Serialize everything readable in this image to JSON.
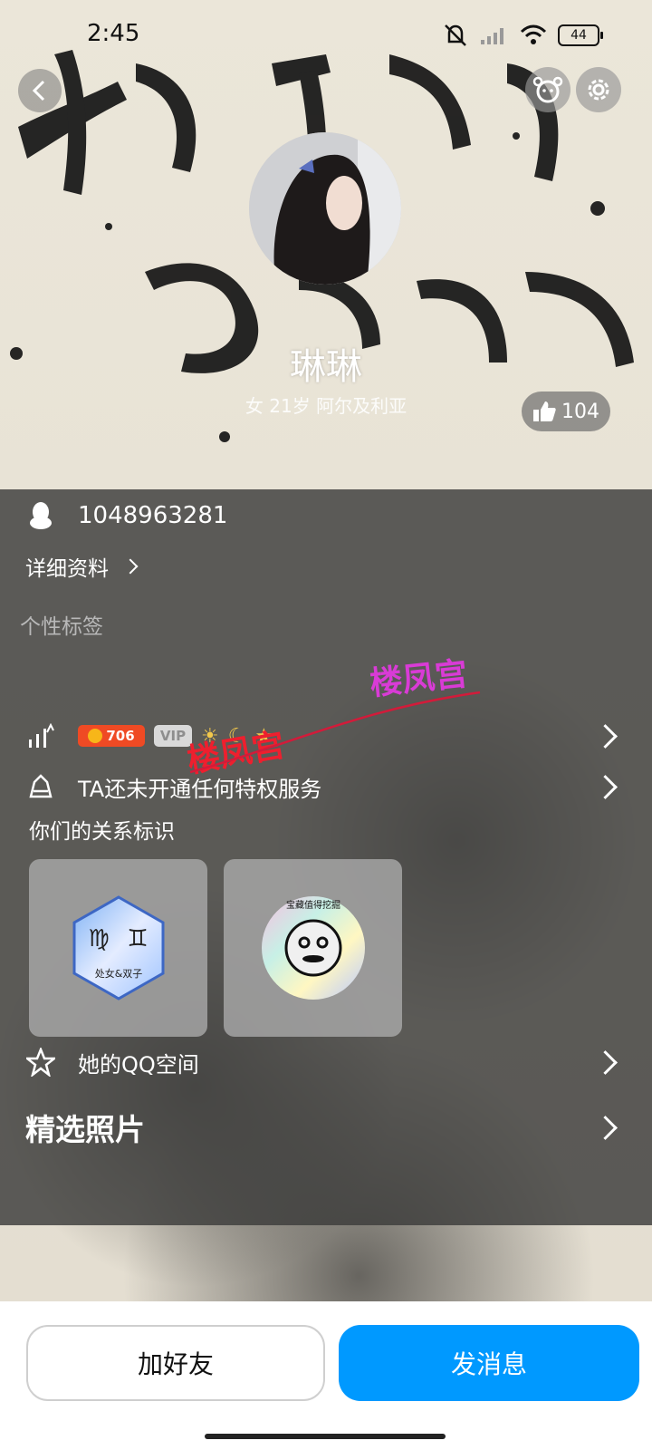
{
  "status": {
    "time": "2:45",
    "battery": "44"
  },
  "profile": {
    "name": "琳琳",
    "subinfo": "女 21岁 阿尔及利亚",
    "likes": "104",
    "qq_number": "1048963281",
    "details_label": "详细资料",
    "tags_label": "个性标签"
  },
  "level": {
    "points": "706",
    "vip_label": "VIP"
  },
  "privilege": {
    "text": "TA还未开通任何特权服务"
  },
  "relationship": {
    "label": "你们的关系标识",
    "cards": [
      {
        "badge_text": "处女&双子",
        "icon": "zodiac-badge-icon"
      },
      {
        "badge_text": "宝藏值得挖掘",
        "icon": "treasure-face-badge-icon"
      }
    ]
  },
  "qzone": {
    "text": "她的QQ空间"
  },
  "photos": {
    "title": "精选照片"
  },
  "watermark": {
    "text": "楼凤宫"
  },
  "actions": {
    "add_friend": "加好友",
    "send_message": "发消息"
  },
  "colors": {
    "primary": "#0099ff",
    "panel": "#3c3c3a"
  }
}
